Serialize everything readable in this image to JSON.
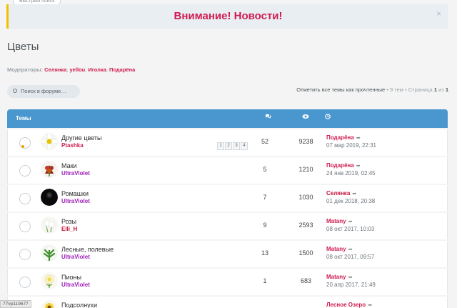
{
  "quick_search_tab": "Быстрый поиск",
  "notice": {
    "text": "Внимание! Новости!",
    "close": "×"
  },
  "page_title": "Цветы",
  "moderators": {
    "label": "Модераторы:",
    "names": [
      "Селянка",
      "yellou",
      "Иголка",
      "Подарёна"
    ]
  },
  "search": {
    "placeholder": "Поиск в форуме…"
  },
  "pager": {
    "mark_read": "Отметить все темы как прочтенные",
    "topics_count": "9 тем",
    "page_label": "Страница",
    "page_current": "1",
    "page_of": "из",
    "page_total": "1"
  },
  "table": {
    "header_title": "Темы",
    "icons": {
      "replies": "comments-icon",
      "views": "eye-icon",
      "last_post": "clock-icon"
    }
  },
  "topics": [
    {
      "title": "Другие цветы",
      "author": "Ptashka",
      "author_color": "#d01b4f",
      "pages": [
        "1",
        "2",
        "3",
        "4"
      ],
      "replies": "52",
      "views": "9238",
      "last_user": "Подарёна",
      "last_user_color": "#d01b4f",
      "last_date": "07 мар 2019, 22:31",
      "unread": true,
      "thumb": "daisy-icon"
    },
    {
      "title": "Маки",
      "author": "UltraViolet",
      "author_color": "#9b1fb6",
      "replies": "5",
      "views": "1210",
      "last_user": "Подарёна",
      "last_user_color": "#d01b4f",
      "last_date": "24 янв 2019, 02:45",
      "thumb": "poppy-icon"
    },
    {
      "title": "Ромашки",
      "author": "UltraViolet",
      "author_color": "#9b1fb6",
      "replies": "7",
      "views": "1030",
      "last_user": "Селянка",
      "last_user_color": "#c01338",
      "last_date": "01 дек 2018, 20:38",
      "thumb": "chamomile-icon"
    },
    {
      "title": "Розы",
      "author": "Elli_H",
      "author_color": "#c01338",
      "replies": "9",
      "views": "2593",
      "last_user": "Matany",
      "last_user_color": "#d01b4f",
      "last_date": "08 окт 2017, 10:03",
      "thumb": "rose-icon"
    },
    {
      "title": "Лесные, полевые",
      "author": "UltraViolet",
      "author_color": "#9b1fb6",
      "replies": "13",
      "views": "1500",
      "last_user": "Matany",
      "last_user_color": "#d01b4f",
      "last_date": "08 окт 2017, 09:57",
      "thumb": "wildflower-icon"
    },
    {
      "title": "Пионы",
      "author": "UltraViolet",
      "author_color": "#9b1fb6",
      "replies": "1",
      "views": "683",
      "last_user": "Matany",
      "last_user_color": "#d01b4f",
      "last_date": "20 апр 2017, 21:49",
      "thumb": "peony-icon"
    },
    {
      "title": "Подсолнухи",
      "author": "",
      "author_color": "#9b1fb6",
      "replies": "",
      "views": "",
      "last_user": "Лесное Озеро",
      "last_user_color": "#d01b4f",
      "last_date": "",
      "thumb": "sunflower-icon"
    }
  ],
  "status_url": "77#p119677"
}
